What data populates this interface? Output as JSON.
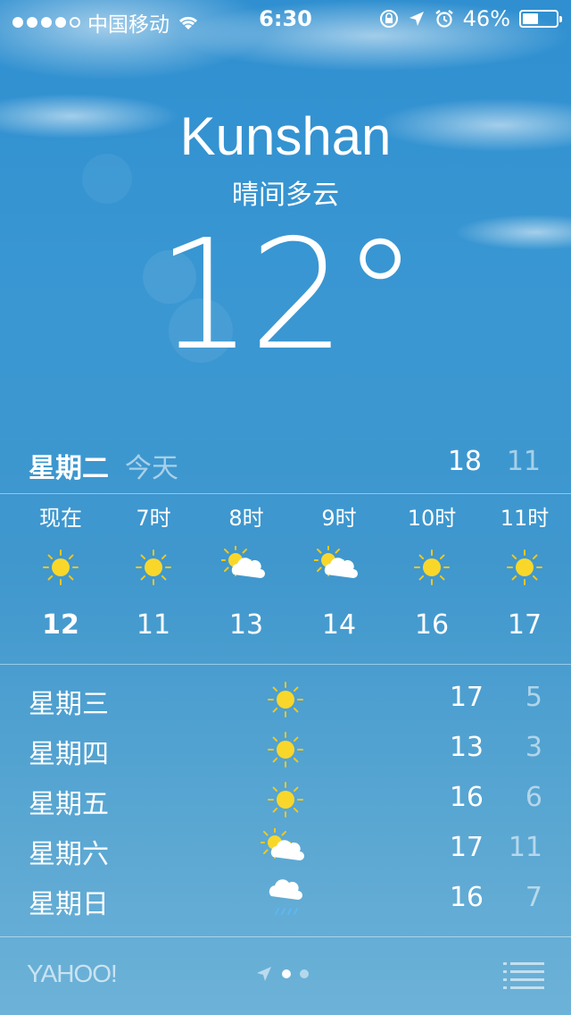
{
  "status_bar": {
    "carrier": "中国移动",
    "time": "6:30",
    "battery": "46%",
    "battery_level": 0.46,
    "signal_bars": 4,
    "signal_total": 5
  },
  "location": {
    "city": "Kunshan",
    "condition": "晴间多云",
    "temperature": "12°"
  },
  "today": {
    "day": "星期二",
    "label": "今天",
    "high": "18",
    "low": "11"
  },
  "hourly": [
    {
      "time": "现在",
      "icon": "sun-icon",
      "temp": "12"
    },
    {
      "time": "7时",
      "icon": "sun-icon",
      "temp": "11"
    },
    {
      "time": "8时",
      "icon": "partly-cloudy-icon",
      "temp": "13"
    },
    {
      "time": "9时",
      "icon": "partly-cloudy-icon",
      "temp": "14"
    },
    {
      "time": "10时",
      "icon": "sun-icon",
      "temp": "16"
    },
    {
      "time": "11时",
      "icon": "sun-icon",
      "temp": "17"
    }
  ],
  "daily": [
    {
      "day": "星期三",
      "icon": "sun-icon",
      "high": "17",
      "low": "5"
    },
    {
      "day": "星期四",
      "icon": "sun-icon",
      "high": "13",
      "low": "3"
    },
    {
      "day": "星期五",
      "icon": "sun-icon",
      "high": "16",
      "low": "6"
    },
    {
      "day": "星期六",
      "icon": "partly-cloudy-icon",
      "high": "17",
      "low": "11"
    },
    {
      "day": "星期日",
      "icon": "rain-cloud-icon",
      "high": "16",
      "low": "7"
    }
  ],
  "footer": {
    "provider": "YAHOO!",
    "page_count": 2,
    "active_page": 0
  },
  "colors": {
    "sun": "#f9d72a",
    "sun_ray": "#f3c81c",
    "cloud": "#ffffff",
    "rain": "#5fb6f0"
  }
}
